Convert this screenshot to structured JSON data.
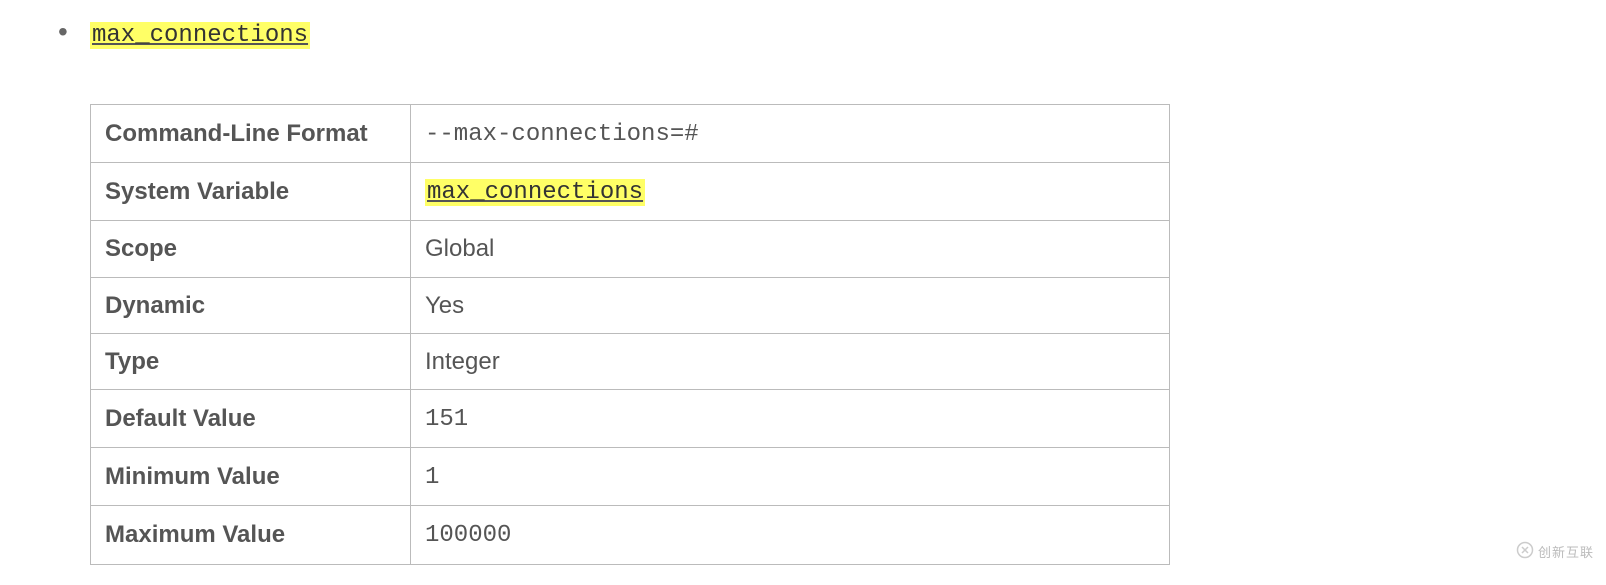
{
  "bullet": {
    "title": "max_connections"
  },
  "table": {
    "rows": [
      {
        "label": "Command-Line Format",
        "value": "--max-connections=#",
        "kind": "mono"
      },
      {
        "label": "System Variable",
        "value": "max_connections",
        "kind": "mono-link"
      },
      {
        "label": "Scope",
        "value": "Global",
        "kind": "text"
      },
      {
        "label": "Dynamic",
        "value": "Yes",
        "kind": "text"
      },
      {
        "label": "Type",
        "value": "Integer",
        "kind": "text"
      },
      {
        "label": "Default Value",
        "value": "151",
        "kind": "mono"
      },
      {
        "label": "Minimum Value",
        "value": "1",
        "kind": "mono"
      },
      {
        "label": "Maximum Value",
        "value": "100000",
        "kind": "mono"
      }
    ]
  },
  "watermark": {
    "text": "创新互联"
  }
}
